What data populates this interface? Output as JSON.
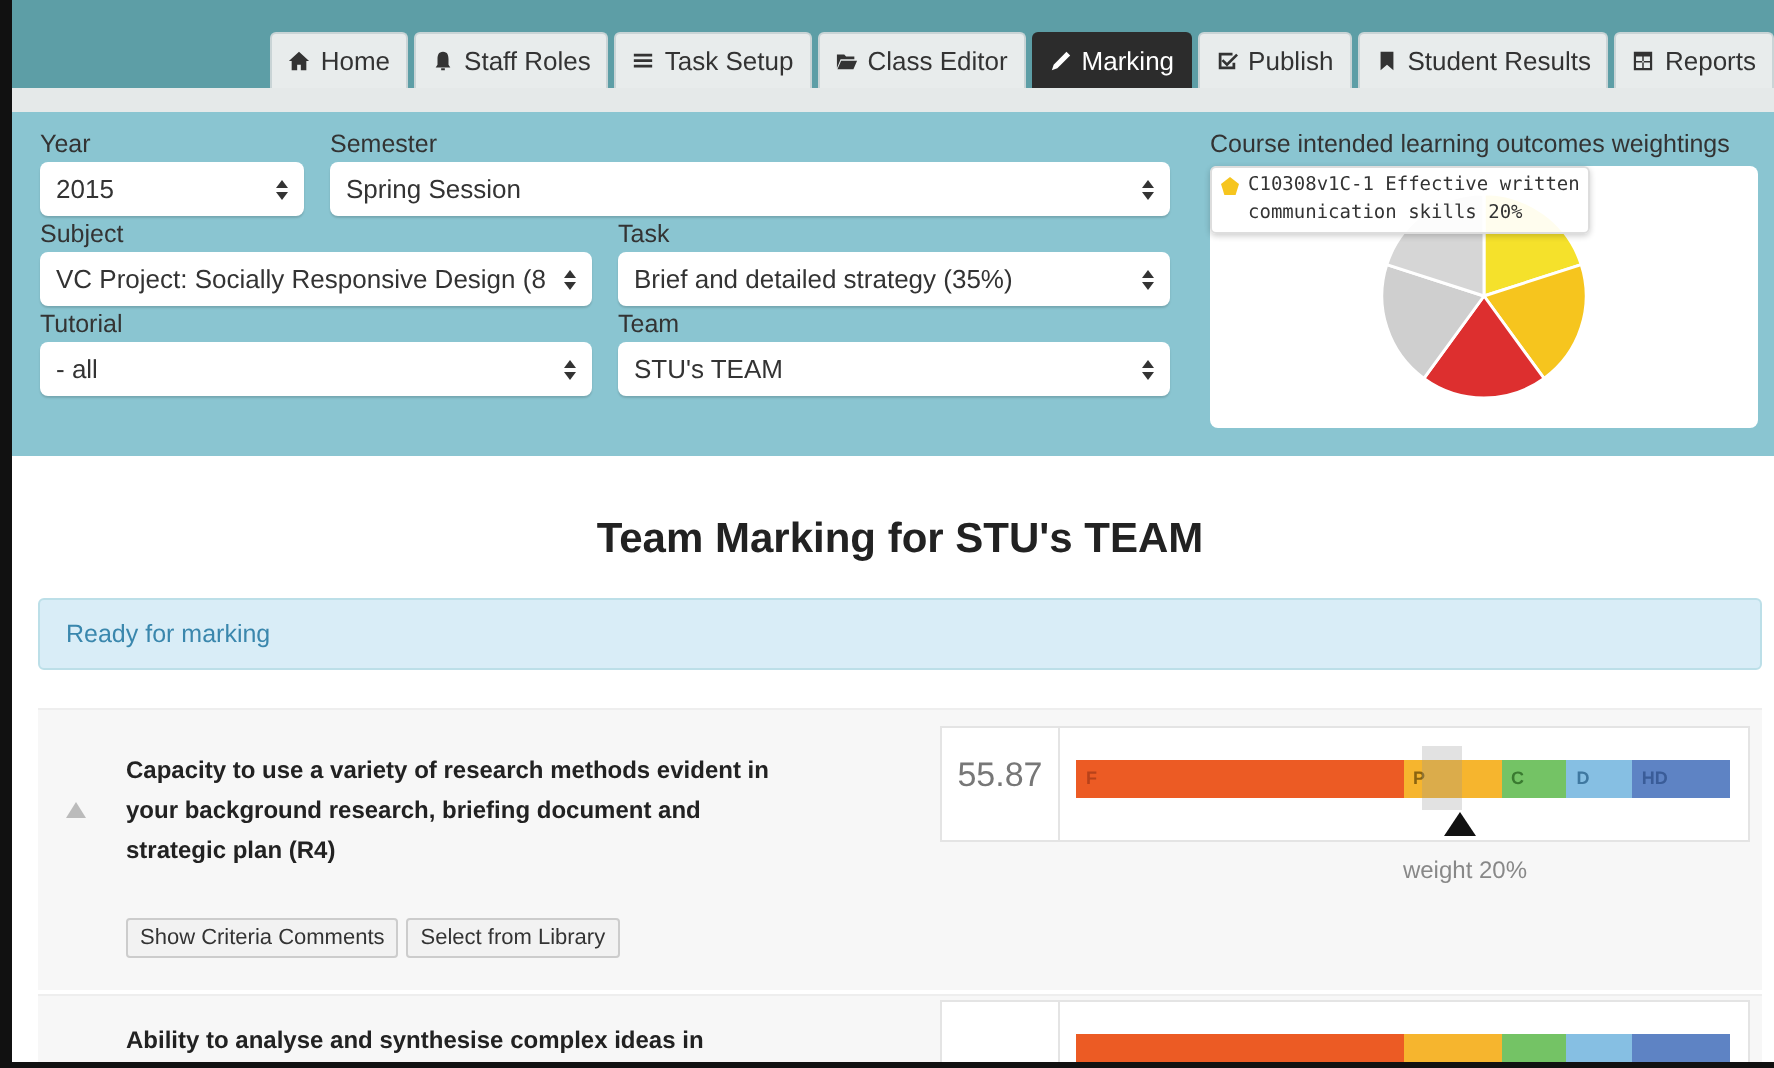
{
  "tabs": [
    {
      "label": "Home",
      "selected": false
    },
    {
      "label": "Staff Roles",
      "selected": false
    },
    {
      "label": "Task Setup",
      "selected": false
    },
    {
      "label": "Class Editor",
      "selected": false
    },
    {
      "label": "Marking",
      "selected": true
    },
    {
      "label": "Publish",
      "selected": false
    },
    {
      "label": "Student Results",
      "selected": false
    },
    {
      "label": "Reports",
      "selected": false
    }
  ],
  "filter_rows": [
    [
      {
        "label": "Year",
        "value": "2015"
      },
      {
        "label": "Semester",
        "value": "Spring Session"
      }
    ],
    [
      {
        "label": "Subject",
        "value": "VC Project: Socially Responsive Design (8"
      },
      {
        "label": "Task",
        "value": "Brief and detailed strategy (35%)"
      }
    ],
    [
      {
        "label": "Tutorial",
        "value": "- all"
      },
      {
        "label": "Team",
        "value": "STU's TEAM"
      }
    ]
  ],
  "outcomes_panel": {
    "title": "Course intended learning outcomes weightings",
    "tooltip": "C10308v1C-1 Effective written communication skills 20%"
  },
  "page_title": "Team Marking for STU's TEAM",
  "status": "Ready for marking",
  "criteria": [
    {
      "text": "Capacity to use a variety of research methods evident in your background research, briefing document and strategic plan (R4)",
      "expanded": true,
      "score": "55.87",
      "level": 0.5587,
      "bands": [
        "F",
        "P",
        "C",
        "D",
        "HD"
      ],
      "weight": "weight 20%",
      "buttons": [
        "Show Criteria Comments",
        "Select from Library"
      ]
    },
    {
      "text": "Ability to analyse and synthesise complex ideas in"
    }
  ]
}
